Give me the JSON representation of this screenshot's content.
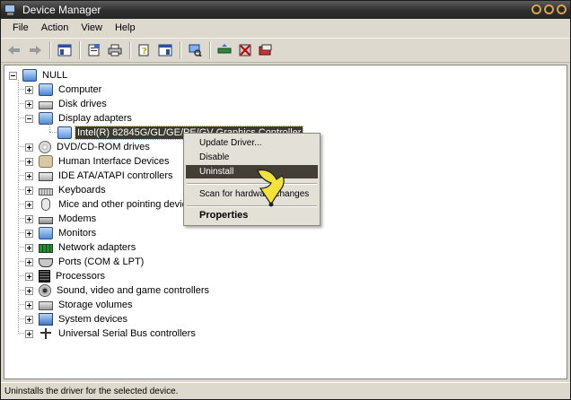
{
  "window": {
    "title": "Device Manager"
  },
  "menu": [
    "File",
    "Action",
    "View",
    "Help"
  ],
  "toolbar": {
    "buttons": [
      "back-icon",
      "forward-icon",
      "show-hide-console-tree-icon",
      "properties-icon",
      "print-icon",
      "help-icon",
      "show-hide-action-pane-icon",
      "scan-hardware-icon",
      "update-driver-icon",
      "disable-device-icon",
      "uninstall-device-icon"
    ]
  },
  "tree": {
    "root": "NULL",
    "items": [
      {
        "label": "Computer",
        "icon": "computer-icon",
        "expanded": false
      },
      {
        "label": "Disk drives",
        "icon": "disk-drive-icon",
        "expanded": false
      },
      {
        "label": "Display adapters",
        "icon": "display-adapter-icon",
        "expanded": true
      },
      {
        "label": "Intel(R) 82845G/GL/GE/PE/GV Graphics Controller",
        "icon": "video-card-icon",
        "child": true,
        "selected": true
      },
      {
        "label": "DVD/CD-ROM drives",
        "icon": "cdrom-icon",
        "expanded": false
      },
      {
        "label": "Human Interface Devices",
        "icon": "hid-icon",
        "expanded": false
      },
      {
        "label": "IDE ATA/ATAPI controllers",
        "icon": "ide-controller-icon",
        "expanded": false
      },
      {
        "label": "Keyboards",
        "icon": "keyboard-icon",
        "expanded": false
      },
      {
        "label": "Mice and other pointing devices",
        "icon": "mouse-icon",
        "expanded": false
      },
      {
        "label": "Modems",
        "icon": "modem-icon",
        "expanded": false
      },
      {
        "label": "Monitors",
        "icon": "monitor-icon",
        "expanded": false
      },
      {
        "label": "Network adapters",
        "icon": "network-adapter-icon",
        "expanded": false
      },
      {
        "label": "Ports (COM & LPT)",
        "icon": "port-icon",
        "expanded": false
      },
      {
        "label": "Processors",
        "icon": "processor-icon",
        "expanded": false
      },
      {
        "label": "Sound, video and game controllers",
        "icon": "sound-icon",
        "expanded": false
      },
      {
        "label": "Storage volumes",
        "icon": "storage-volume-icon",
        "expanded": false
      },
      {
        "label": "System devices",
        "icon": "system-device-icon",
        "expanded": false
      },
      {
        "label": "Universal Serial Bus controllers",
        "icon": "usb-icon",
        "expanded": false
      }
    ]
  },
  "context_menu": {
    "items": [
      {
        "label": "Update Driver...",
        "highlighted": false
      },
      {
        "label": "Disable",
        "highlighted": false
      },
      {
        "label": "Uninstall",
        "highlighted": true
      },
      {
        "label": "Scan for hardware changes",
        "highlighted": false
      },
      {
        "label": "Properties",
        "bold": true
      }
    ]
  },
  "status": {
    "text": "Uninstalls the driver for the selected device."
  },
  "colors": {
    "selection": "#3d3a33",
    "titlebar": "#2e2e2e",
    "accent": "#d9a34a"
  }
}
